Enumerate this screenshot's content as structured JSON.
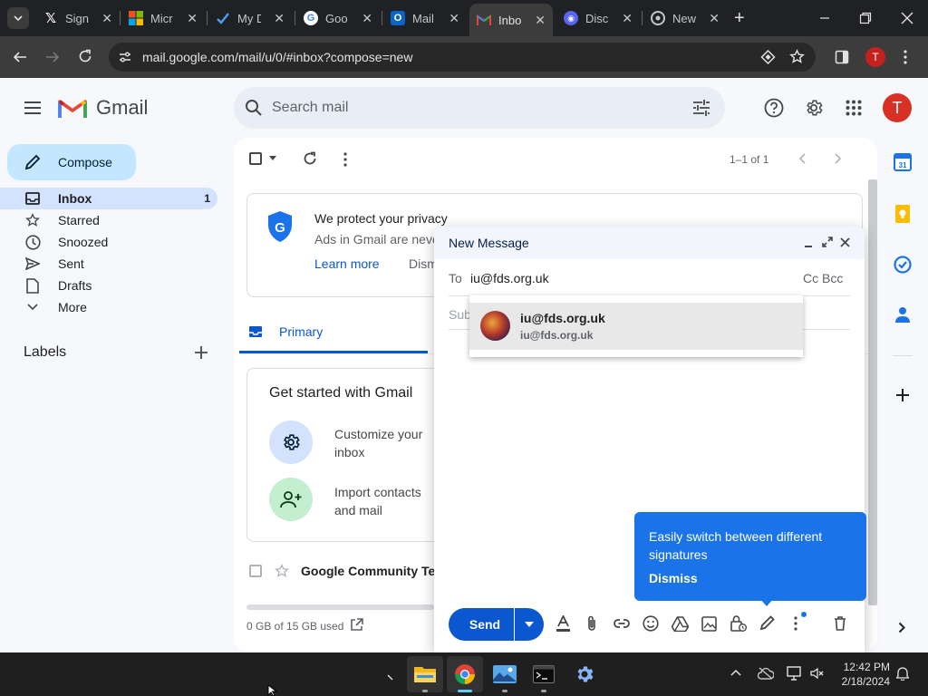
{
  "browser": {
    "tabs": [
      {
        "title": "Sign",
        "icon": "x-logo-icon"
      },
      {
        "title": "Micr",
        "icon": "microsoft-logo-icon"
      },
      {
        "title": "My D",
        "icon": "todo-check-icon"
      },
      {
        "title": "Goo",
        "icon": "google-logo-icon"
      },
      {
        "title": "Mail",
        "icon": "outlook-logo-icon"
      },
      {
        "title": "Inbo",
        "icon": "gmail-logo-icon"
      },
      {
        "title": "Disc",
        "icon": "discord-logo-icon"
      },
      {
        "title": "New",
        "icon": "chrome-logo-icon"
      }
    ],
    "url": "mail.google.com/mail/u/0/#inbox?compose=new",
    "profile_initial": "T"
  },
  "gmail": {
    "logo_text": "Gmail",
    "search_placeholder": "Search mail",
    "avatar_initial": "T",
    "compose_label": "Compose",
    "nav": [
      {
        "label": "Inbox",
        "count": "1"
      },
      {
        "label": "Starred",
        "count": ""
      },
      {
        "label": "Snoozed",
        "count": ""
      },
      {
        "label": "Sent",
        "count": ""
      },
      {
        "label": "Drafts",
        "count": ""
      },
      {
        "label": "More",
        "count": ""
      }
    ],
    "labels_heading": "Labels",
    "pagination": "1–1 of 1",
    "privacy": {
      "title": "We protect your privacy",
      "body": "Ads in Gmail are neve",
      "learn_more": "Learn more",
      "dismiss": "Dism"
    },
    "tab_primary": "Primary",
    "get_started": {
      "title": "Get started with Gmail",
      "item1": "Customize your inbox",
      "item1_line1": "Customize your",
      "item1_line2": "inbox",
      "item2_line1": "Import contacts",
      "item2_line2": "and mail"
    },
    "email_row_sender": "Google Community Te",
    "storage": "0 GB of 15 GB used"
  },
  "compose": {
    "title": "New Message",
    "to_label": "To",
    "to_value": "iu@fds.org.uk",
    "cc_bcc": "Cc Bcc",
    "subject_placeholder": "Sub",
    "suggestion": {
      "name": "iu@fds.org.uk",
      "email": "iu@fds.org.uk"
    },
    "tooltip": {
      "text": "Easily switch between different signatures",
      "dismiss": "Dismiss"
    },
    "send_label": "Send"
  },
  "taskbar": {
    "time": "12:42 PM",
    "date": "2/18/2024"
  },
  "colors": {
    "accent_blue": "#0b57d0",
    "selected_nav": "#d3e3fd",
    "compose_btn": "#c2e7ff",
    "tooltip_blue": "#1a73e8",
    "avatar_red": "#d93025"
  }
}
